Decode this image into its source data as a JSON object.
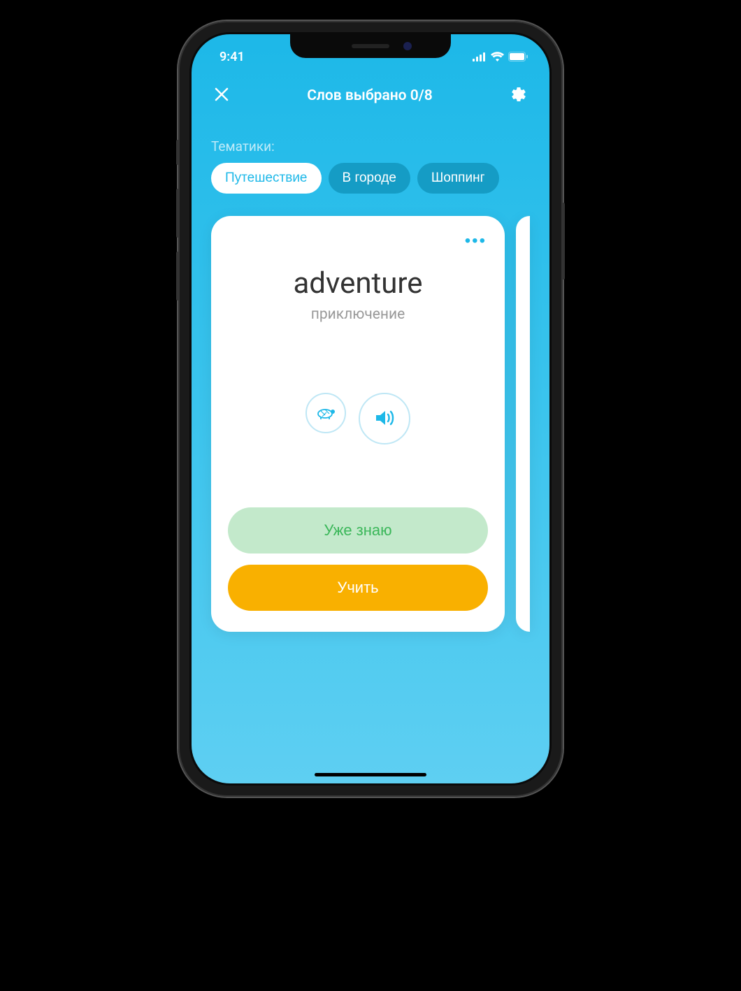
{
  "status": {
    "time": "9:41"
  },
  "header": {
    "title": "Слов выбрано 0/8"
  },
  "topics": {
    "label": "Тематики:",
    "chips": [
      {
        "label": "Путешествие",
        "active": true
      },
      {
        "label": "В городе",
        "active": false
      },
      {
        "label": "Шоппинг",
        "active": false
      }
    ]
  },
  "card": {
    "word": "adventure",
    "translation": "приключение",
    "actions": {
      "known": "Уже знаю",
      "learn": "Учить"
    }
  },
  "icons": {
    "close": "close-icon",
    "settings": "gear-icon",
    "more": "more-horizontal-icon",
    "slow_audio": "turtle-icon",
    "audio": "speaker-icon"
  }
}
